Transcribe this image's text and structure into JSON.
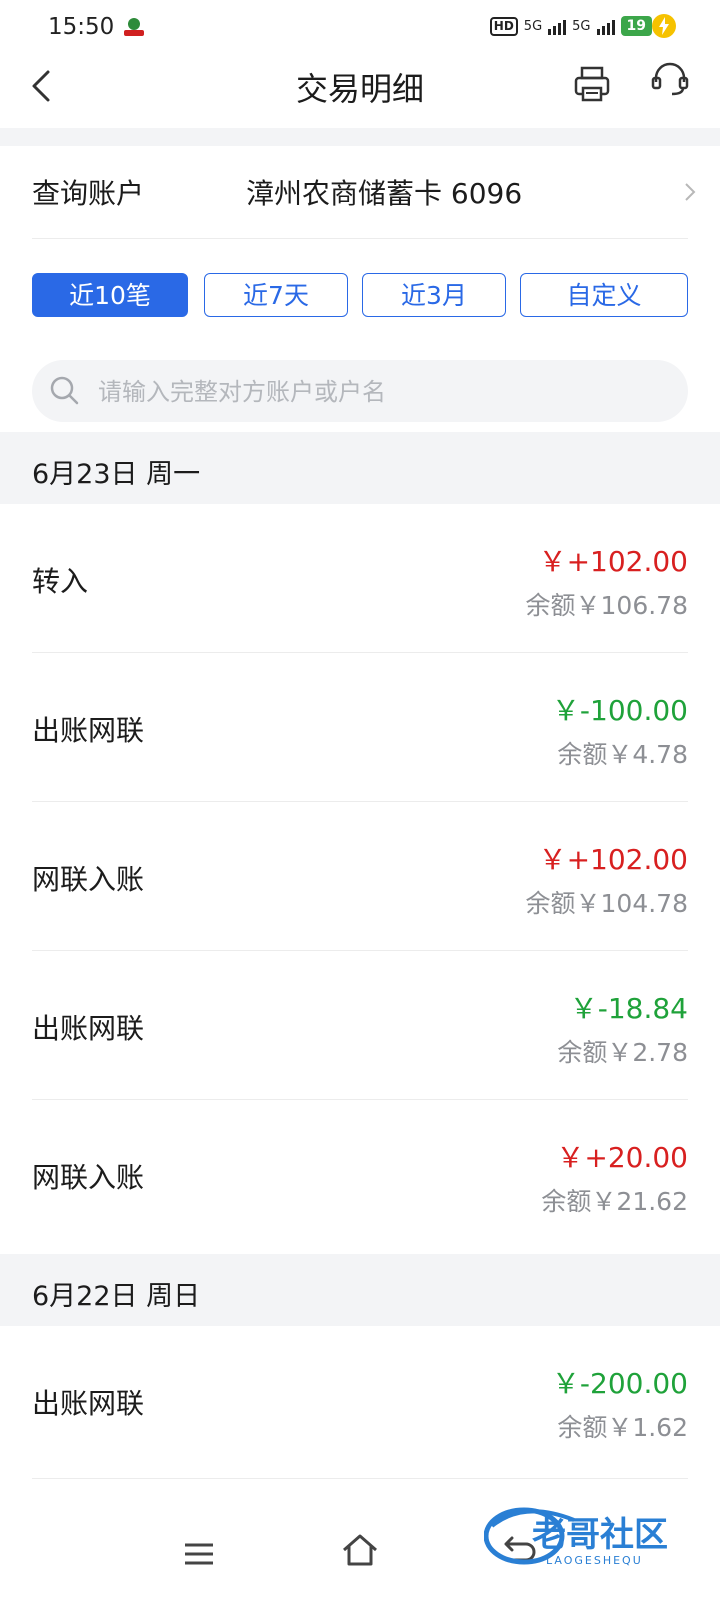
{
  "status": {
    "time": "15:50",
    "hd": "HD",
    "net1": "5G",
    "net2": "5G",
    "battery": "19"
  },
  "header": {
    "title": "交易明细"
  },
  "account": {
    "label": "查询账户",
    "value": "漳州农商储蓄卡 6096"
  },
  "filters": [
    {
      "label": "近10笔",
      "active": true
    },
    {
      "label": "近7天"
    },
    {
      "label": "近3月"
    },
    {
      "label": "自定义"
    }
  ],
  "search": {
    "placeholder": "请输入完整对方账户或户名"
  },
  "groups": [
    {
      "date": "6月23日 周一",
      "items": [
        {
          "name": "转入",
          "amount": "￥+102.00",
          "balance": "余额￥106.78",
          "type": "in"
        },
        {
          "name": "出账网联",
          "amount": "￥-100.00",
          "balance": "余额￥4.78",
          "type": "out"
        },
        {
          "name": "网联入账",
          "amount": "￥+102.00",
          "balance": "余额￥104.78",
          "type": "in"
        },
        {
          "name": "出账网联",
          "amount": "￥-18.84",
          "balance": "余额￥2.78",
          "type": "out"
        },
        {
          "name": "网联入账",
          "amount": "￥+20.00",
          "balance": "余额￥21.62",
          "type": "in"
        }
      ]
    },
    {
      "date": "6月22日 周日",
      "items": [
        {
          "name": "出账网联",
          "amount": "￥-200.00",
          "balance": "余额￥1.62",
          "type": "out"
        }
      ]
    }
  ],
  "watermark": {
    "main": "老哥社区",
    "sub": "LAOGESHEQU"
  },
  "colors": {
    "accent": "#2a69e6",
    "income": "#d82020",
    "expense": "#1fa23a"
  }
}
